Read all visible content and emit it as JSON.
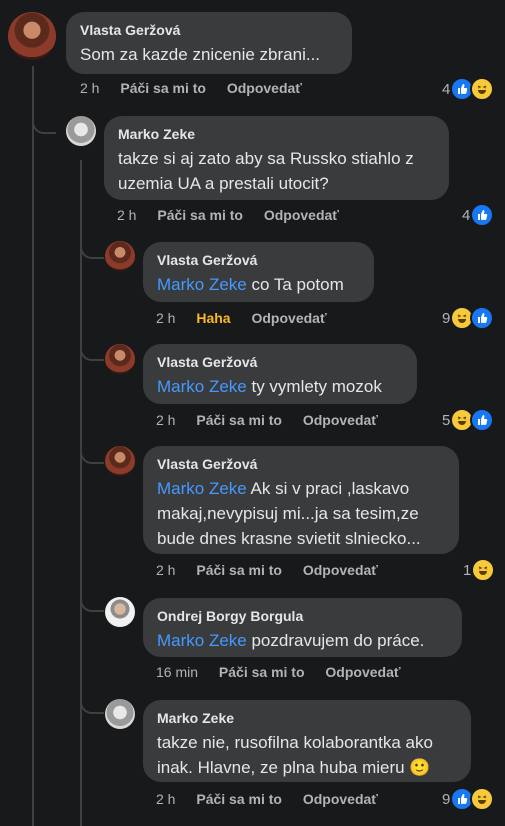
{
  "comments": [
    {
      "author": "Vlasta Geržová",
      "text": "Som za kazde znicenie zbrani...",
      "time": "2 h",
      "like": "Páči sa mi to",
      "reply": "Odpovedať",
      "count": "4"
    },
    {
      "author": "Marko Zeke",
      "text": "takze si aj zato aby sa Russko stiahlo z uzemia UA a prestali utocit?",
      "time": "2 h",
      "like": "Páči sa mi to",
      "reply": "Odpovedať",
      "count": "4"
    },
    {
      "author": "Vlasta Geržová",
      "mention": "Marko Zeke",
      "text": " co Ta potom",
      "time": "2 h",
      "like": "Haha",
      "reply": "Odpovedať",
      "count": "9"
    },
    {
      "author": "Vlasta Geržová",
      "mention": "Marko Zeke",
      "text": " ty vymlety mozok",
      "time": "2 h",
      "like": "Páči sa mi to",
      "reply": "Odpovedať",
      "count": "5"
    },
    {
      "author": "Vlasta Geržová",
      "mention": "Marko Zeke",
      "text": " Ak si v praci ,laskavo makaj,nevypisuj mi...ja sa tesim,ze bude dnes krasne svietit slniecko...",
      "time": "2 h",
      "like": "Páči sa mi to",
      "reply": "Odpovedať",
      "count": "1"
    },
    {
      "author": "Ondrej Borgy Borgula",
      "mention": "Marko Zeke",
      "text": " pozdravujem do práce.",
      "time": "16 min",
      "like": "Páči sa mi to",
      "reply": "Odpovedať"
    },
    {
      "author": "Marko Zeke",
      "text": "takze nie, rusofilna kolaborantka ako inak. Hlavne, ze plna huba mieru 🙂",
      "time": "2 h",
      "like": "Páči sa mi to",
      "reply": "Odpovedať",
      "count": "9"
    }
  ],
  "colors": {
    "background": "#18191a",
    "bubble": "#3a3b3c",
    "mention": "#4599ff",
    "haha": "#f7b928",
    "like": "#1877f2"
  },
  "icons": [
    "like-icon",
    "haha-icon"
  ]
}
